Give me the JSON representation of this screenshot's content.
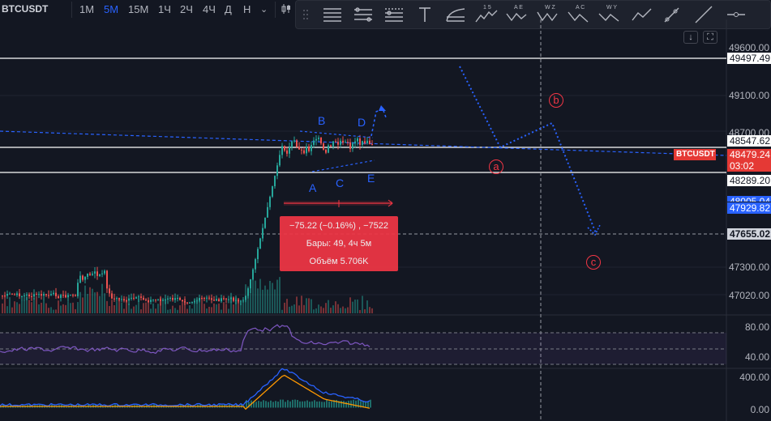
{
  "symbol": "BTCUSDT",
  "timeframes": [
    "1M",
    "5M",
    "15M",
    "1Ч",
    "2Ч",
    "4Ч",
    "Д",
    "Н"
  ],
  "active_timeframe": "5M",
  "price_axis": {
    "ticks": [
      "49600.00",
      "49100.00",
      "48700.00",
      "47300.00",
      "47020.00"
    ],
    "labels": {
      "level_top": "49497.49",
      "level_mid": "48547.62",
      "last_price": "48479.24",
      "countdown": "03:02",
      "level_low": "48289.20",
      "blue_price_partial": "48005.04",
      "blue_price": "47929.82",
      "crosshair_price": "47655.02",
      "symbol_tag": "BTCUSDT"
    }
  },
  "rsi_axis": {
    "ticks": [
      "80.00",
      "40.00"
    ]
  },
  "macd_axis": {
    "ticks": [
      "400.00",
      "0.00"
    ]
  },
  "tooltip": {
    "line1": "−75.22 (−0.16%) , −7522",
    "line2": "Бары: 49, 4ч 5м",
    "line3": "Объём 5.706K"
  },
  "wave_labels": [
    "A",
    "B",
    "C",
    "D",
    "E"
  ],
  "correction_labels": [
    "a",
    "b",
    "c"
  ],
  "toolbar_icons": [
    "grip-icon",
    "horizontal-lines-icon",
    "parallel-channel-icon",
    "pitchfork-icon",
    "text-icon",
    "fib-retracement-icon",
    "impulse-wave-icon",
    "triangle-wave-icon",
    "wxyxz-wave-icon",
    "abc-wave-icon",
    "wxy-wave-icon",
    "path-icon",
    "ray-icon",
    "trend-line-icon",
    "horizontal-ray-icon"
  ],
  "toolbar_wave_texts": {
    "impulse": "1 5",
    "triangle": "A E",
    "wxyxz": "W Z",
    "abc": "A C",
    "wxy": "W Y"
  },
  "colors": {
    "background": "#131722",
    "accent_blue": "#2962ff",
    "up_green": "#26a69a",
    "down_red": "#ef5350",
    "rsi_line": "#7e57c2",
    "macd_blue": "#2962ff",
    "macd_orange": "#ff9800"
  }
}
